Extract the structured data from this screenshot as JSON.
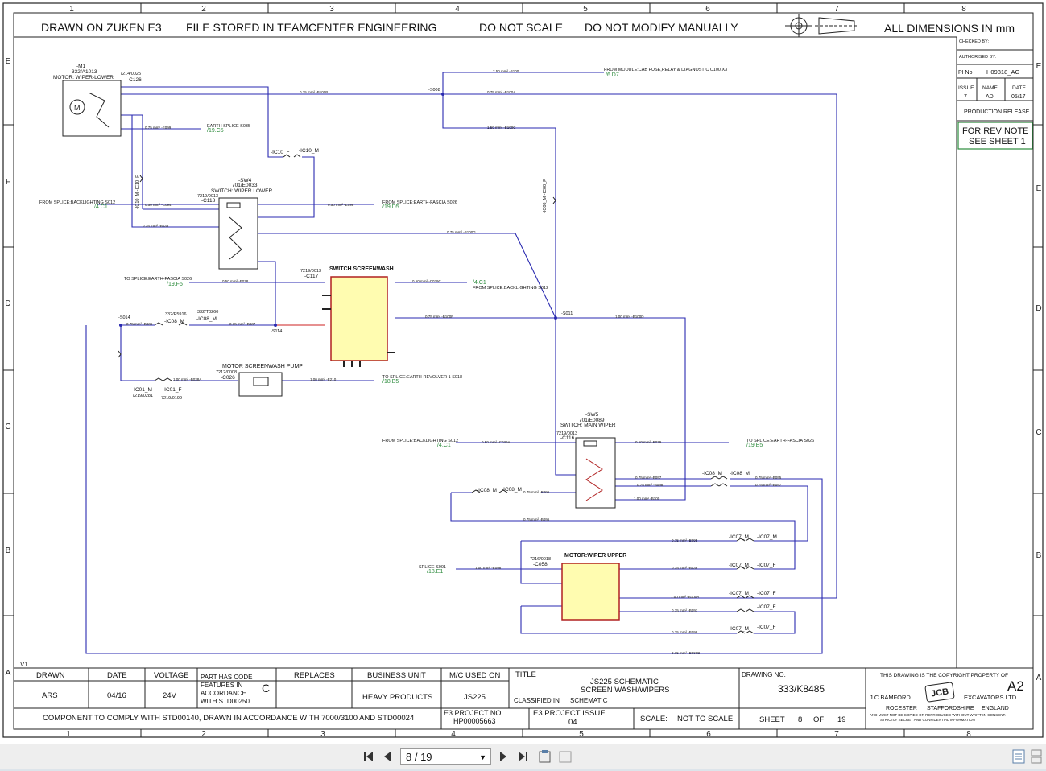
{
  "grid": {
    "columns": [
      "1",
      "2",
      "3",
      "4",
      "5",
      "6",
      "7",
      "8"
    ],
    "rows_left": [
      "E",
      "F",
      "D",
      "C",
      "B",
      "A"
    ],
    "rows_right": [
      "E",
      "E",
      "D",
      "C",
      "B",
      "A"
    ]
  },
  "header_notes": [
    "DRAWN ON ZUKEN E3",
    "FILE STORED IN TEAMCENTER ENGINEERING",
    "DO NOT SCALE",
    "DO NOT MODIFY MANUALLY",
    "ALL DIMENSIONS IN mm"
  ],
  "side_panel": {
    "checked_by": "CHECKED BY:",
    "authorised_by": "AUTHORISED BY:",
    "pi_no_label": "PI No",
    "pi_no_value": "H09818_AG",
    "issue_label": "ISSUE",
    "name_label": "NAME",
    "date_label": "DATE",
    "issue_value": "7",
    "name_value": "AD",
    "date_value": "05/17",
    "production_release": "PRODUCTION RELEASE",
    "rev_note_line1": "FOR REV NOTE",
    "rev_note_line2": "SEE SHEET 1"
  },
  "version_mark": "V1",
  "components": {
    "m1": {
      "ref": "-M1",
      "part": "332/A1013",
      "name": "MOTOR: WIPER-LOWER",
      "conn_part": "7214/0025",
      "conn": "-C126"
    },
    "sw4": {
      "ref": "-SW4",
      "part": "701/E0033",
      "name": "SWITCH: WIPER LOWER",
      "conn_part": "7219/0013",
      "conn": "-C118"
    },
    "screenwash": {
      "name": "SWITCH SCREENWASH",
      "conn_part": "7219/0013",
      "conn": "-C117"
    },
    "pump": {
      "name": "MOTOR SCREENWASH PUMP",
      "conn_part": "7212/0008",
      "conn": "-C026"
    },
    "sw5": {
      "ref": "-SW5",
      "part": "701/E0089",
      "name": "SWITCH: MAIN WIPER",
      "conn_part": "7219/0013",
      "conn": "-C116"
    },
    "motor_upper": {
      "name": "MOTOR:WIPER UPPER",
      "conn_part": "7216/0018",
      "conn": "-C058"
    }
  },
  "labels": {
    "from_module": "FROM MODULE:CAB FUSE,RELAY & DIAGNOSTIC C100 X3",
    "from_module_ref": "/6.D7",
    "earth_s035": "EARTH SPLICE S035",
    "earth_s035_ref": "/19.C5",
    "from_backlighting_1": "FROM SPLICE:BACKLIGHTING S012",
    "from_backlighting_1_ref": "/4.C1",
    "from_earth_fascia": "FROM SPLICE:EARTH-FASCIA S026",
    "from_earth_fascia_ref": "/19.D5",
    "to_earth_fascia": "TO SPLICE:EARTH-FASCIA S026",
    "to_earth_fascia_ref": "/19.F5",
    "from_backlighting_2": "FROM SPLICE:BACKLIGHTING S012",
    "from_backlighting_2_ref": "/4.C1",
    "to_earth_revolver": "TO SPLICE:EARTH-REVOLVER 1 S018",
    "to_earth_revolver_ref": "/18.B5",
    "from_backlighting_3": "FROM SPLICE:BACKLIGHTING S012",
    "from_backlighting_3_ref": "/4.C1",
    "to_earth_fascia_2": "TO SPLICE:EARTH-FASCIA S026",
    "to_earth_fascia_2_ref": "/19.E5",
    "splice_s001": "SPLICE S001",
    "splice_s001_ref": "/18.E1",
    "s008": "-S008",
    "s011": "-S011",
    "s014": "-S014",
    "s114": "-S114",
    "ic10_f": "-IC10_F",
    "ic10_m": "-IC10_M",
    "ic10_mf": "-IC10_M -IC10_F",
    "ic08_m_f": "-IC08_M",
    "ic08_m": "-IC08_M",
    "ic08_part": "332/E5916",
    "ic08_part2": "332/T0260",
    "ic01_m": "-IC01_M",
    "ic01_f": "-IC01_F",
    "ic01_part": "7219/0281",
    "ic01_part2": "7219/0199",
    "ic08_vert": "-IC08_M -IC08_F",
    "ic08_a": "-IC08_M",
    "ic08_b": "-IC08_M",
    "ic08_c": "-IC08_M",
    "ic08_d": "-IC08_M",
    "ic07_m": "-IC07_M",
    "ic07_f": "-IC07_F"
  },
  "wires": {
    "w1": "0.75 mm² -B100B",
    "w2": "0.75 mm² -B100A",
    "w3": "2.50 mm² -B100",
    "w4": "1.50 mm² -B100C",
    "w5": "0.75 mm² -E099",
    "w6": "0.50 mm² -C094",
    "w7": "0.75 mm² -B033",
    "w8": "0.50 mm² -E098",
    "w9": "0.75 mm² -B100G",
    "w10": "0.50 mm² -E078",
    "w11": "0.50 mm² -C039C",
    "w12": "0.75 mm² -B100F",
    "w13": "1.00 mm² -B100D",
    "w14": "0.75 mm² -B036",
    "w15": "0.75 mm² -B037",
    "w16": "1.00 mm² -B038A",
    "w17": "1.00 mm² -E210",
    "w18": "0.50 mm² -C039A",
    "w19": "0.50 mm² -E079",
    "w20": "0.75 mm² -B097",
    "w21": "0.75 mm² -B098",
    "w22": "1.00 mm² -B100",
    "w23": "0.75 mm² -B096",
    "w24": "0.75 mm² -B095",
    "w25": "1.00 mm² -E098",
    "w26": "1.00 mm² -B100A",
    "w27": "0.75 mm² -B096B",
    "w28": "0.75 mm² -B097",
    "w29": "0.75 mm² -B098",
    "w30": "0.75 mm² -B095"
  },
  "title_block": {
    "drawn_label": "DRAWN",
    "drawn_value": "ARS",
    "date_label": "DATE",
    "date_value": "04/16",
    "voltage_label": "VOLTAGE",
    "voltage_value": "24V",
    "part_code_note": [
      "PART HAS CODE",
      "FEATURES IN",
      "ACCORDANCE",
      "WITH STD00250"
    ],
    "part_code_letter": "C",
    "replaces_label": "REPLACES",
    "business_unit_label": "BUSINESS UNIT",
    "business_unit_value": "HEAVY PRODUCTS",
    "mc_used_label": "M/C USED ON",
    "mc_used_value": "JS225",
    "title_label": "TITLE",
    "title_line1": "JS225 SCHEMATIC",
    "title_line2": "SCREEN WASH/WIPERS",
    "classified_label": "CLASSIFIED IN",
    "classified_value": "SCHEMATIC",
    "drawing_no_label": "DRAWING NO.",
    "drawing_no_value": "333/K8485",
    "comply_note": "COMPONENT TO COMPLY WITH STD00140, DRAWN IN ACCORDANCE WITH 7000/3100 AND STD00024",
    "e3_project_label": "E3 PROJECT NO.",
    "e3_project_value": "HP00005663",
    "e3_issue_label": "E3 PROJECT ISSUE",
    "e3_issue_value": "04",
    "scale_label": "SCALE:",
    "scale_value": "NOT TO SCALE",
    "sheet_label": "SHEET",
    "sheet_value": "8",
    "of_label": "OF",
    "of_value": "19",
    "copyright": "THIS DRAWING IS THE COPYRIGHT PROPERTY OF",
    "size": "A2",
    "company_left": "J.C.BAMFORD",
    "company_right": "EXCAVATORS LTD",
    "address": [
      "ROCESTER",
      "STAFFORDSHIRE",
      "ENGLAND"
    ],
    "secret_note1": "AND MUST NOT BE COPIED OR REPRODUCED WITHOUT WRITTEN CONSENT.",
    "secret_note2": "STRICTLY SECRET AND CONFIDENTIAL INFORMATION",
    "logo": "JCB"
  },
  "viewer": {
    "page_display": "8 / 19",
    "icons": [
      "first-page-icon",
      "prev-page-icon",
      "next-page-icon",
      "last-page-icon",
      "fit-page-icon",
      "fit-width-icon",
      "single-page-icon",
      "continuous-icon"
    ]
  }
}
